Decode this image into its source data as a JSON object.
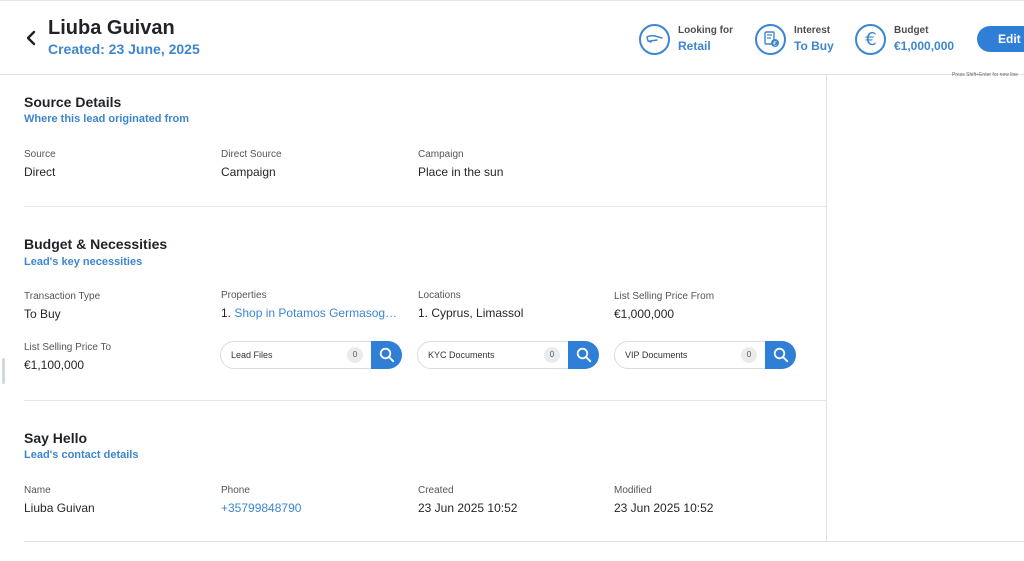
{
  "header": {
    "title": "Liuba Guivan",
    "created": "Created: 23 June, 2025",
    "stats": [
      {
        "label": "Looking for",
        "value": "Retail",
        "icon": "hand-icon"
      },
      {
        "label": "Interest",
        "value": "To Buy",
        "icon": "contract-euro-icon"
      },
      {
        "label": "Budget",
        "value": "€1,000,000",
        "icon": "euro-icon"
      }
    ],
    "edit_label": "Edit",
    "hint": "Press Shift+Enter for new line"
  },
  "source": {
    "title": "Source Details",
    "subtitle": "Where this lead originated from",
    "fields": [
      {
        "label": "Source",
        "value": "Direct"
      },
      {
        "label": "Direct Source",
        "value": "Campaign"
      },
      {
        "label": "Campaign",
        "value": "Place in the sun"
      }
    ]
  },
  "budget": {
    "title": "Budget & Necessities",
    "subtitle": "Lead's key necessities",
    "transaction_type": {
      "label": "Transaction Type",
      "value": "To Buy"
    },
    "properties": {
      "label": "Properties",
      "index": "1.",
      "value": "Shop in Potamos Germasogeias"
    },
    "locations": {
      "label": "Locations",
      "value": "1. Cyprus, Limassol"
    },
    "price_from": {
      "label": "List Selling Price From",
      "value": "€1,000,000"
    },
    "price_to": {
      "label": "List Selling Price To",
      "value": "€1,100,000"
    },
    "docs": [
      {
        "label": "Lead Files",
        "count": "0"
      },
      {
        "label": "KYC Documents",
        "count": "0"
      },
      {
        "label": "VIP Documents",
        "count": "0"
      }
    ]
  },
  "hello": {
    "title": "Say Hello",
    "subtitle": "Lead's contact details",
    "fields": [
      {
        "label": "Name",
        "value": "Liuba Guivan"
      },
      {
        "label": "Phone",
        "value": "+35799848790"
      },
      {
        "label": "Created",
        "value": "23 Jun 2025 10:52"
      },
      {
        "label": "Modified",
        "value": "23 Jun 2025 10:52"
      }
    ]
  },
  "colors": {
    "accent": "#3d86cf",
    "button": "#2f7fd6"
  }
}
